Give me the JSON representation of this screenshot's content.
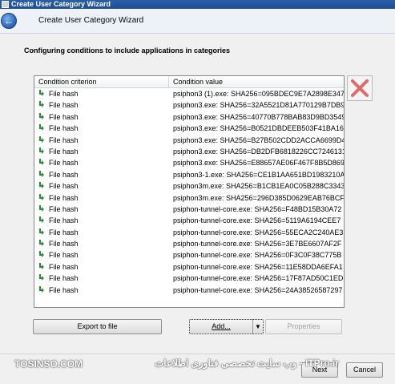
{
  "window": {
    "title": "Create User Category Wizard"
  },
  "header": {
    "title": "Create User Category Wizard"
  },
  "page": {
    "subtitle": "Configuring conditions to include applications in categories"
  },
  "list": {
    "columns": [
      "Condition criterion",
      "Condition value"
    ],
    "rows": [
      {
        "criterion": "File hash",
        "value": "psiphon3 (1).exe: SHA256=095BDEC9E7A2898E347"
      },
      {
        "criterion": "File hash",
        "value": "psiphon3.exe: SHA256=32A5521D81A770129B7DB9"
      },
      {
        "criterion": "File hash",
        "value": "psiphon3.exe: SHA256=40770B778BAB83D9BD3549"
      },
      {
        "criterion": "File hash",
        "value": "psiphon3.exe: SHA256=B0521DBDEEB503F41BA169"
      },
      {
        "criterion": "File hash",
        "value": "psiphon3.exe: SHA256=B27B502CDD2ACCA6699D4"
      },
      {
        "criterion": "File hash",
        "value": "psiphon3.exe: SHA256=DB2DFB6818226CC7246131"
      },
      {
        "criterion": "File hash",
        "value": "psiphon3.exe: SHA256=E88657AE06F467F8B5D869"
      },
      {
        "criterion": "File hash",
        "value": "psiphon3-1.exe: SHA256=CE1B1AA651BD1983210A"
      },
      {
        "criterion": "File hash",
        "value": "psiphon3m.exe: SHA256=B1CB1EA0C05B288C33432"
      },
      {
        "criterion": "File hash",
        "value": "psiphon3m.exe: SHA256=296D385D0629EAB76BCF"
      },
      {
        "criterion": "File hash",
        "value": "psiphon-tunnel-core.exe: SHA256=F48BD15B30A72"
      },
      {
        "criterion": "File hash",
        "value": "psiphon-tunnel-core.exe: SHA256=5119A6194CEE7"
      },
      {
        "criterion": "File hash",
        "value": "psiphon-tunnel-core.exe: SHA256=55ECA2C240AE3"
      },
      {
        "criterion": "File hash",
        "value": "psiphon-tunnel-core.exe: SHA256=3E7BE6607AF2F"
      },
      {
        "criterion": "File hash",
        "value": "psiphon-tunnel-core.exe: SHA256=0F3C0F38C775B"
      },
      {
        "criterion": "File hash",
        "value": "psiphon-tunnel-core.exe: SHA256=11E58DDA6EFA1"
      },
      {
        "criterion": "File hash",
        "value": "psiphon-tunnel-core.exe: SHA256=17F87AD50C1ED"
      },
      {
        "criterion": "File hash",
        "value": "psiphon-tunnel-core.exe: SHA256=24A38526587297"
      }
    ]
  },
  "buttons": {
    "export": "Export to file",
    "add": "Add...",
    "properties": "Properties",
    "next": "Next",
    "cancel": "Cancel"
  },
  "watermark": {
    "left": "TOSINSO.COM",
    "right": "ITPro.ir - وب سایت تخصصی فناوری اطلاعات"
  },
  "colors": {
    "title_bar": "#1d4c91",
    "hash_icon": "#2e8b3a",
    "delete_x": "#e06a6a"
  }
}
